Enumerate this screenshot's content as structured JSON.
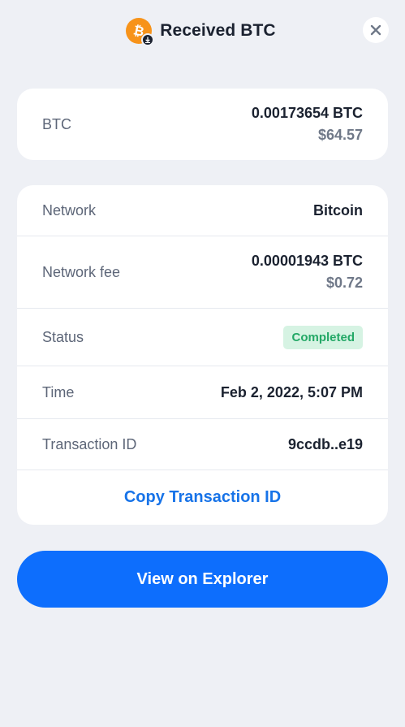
{
  "header": {
    "title": "Received BTC",
    "coin_icon": "bitcoin-icon",
    "badge_icon": "download-arrow-icon",
    "close_icon": "close-icon"
  },
  "amount": {
    "label": "BTC",
    "crypto_value": "0.00173654 BTC",
    "fiat_value": "$64.57"
  },
  "details": {
    "network": {
      "label": "Network",
      "value": "Bitcoin"
    },
    "fee": {
      "label": "Network fee",
      "crypto_value": "0.00001943 BTC",
      "fiat_value": "$0.72"
    },
    "status": {
      "label": "Status",
      "value": "Completed"
    },
    "time": {
      "label": "Time",
      "value": "Feb 2, 2022, 5:07 PM"
    },
    "transaction": {
      "label": "Transaction ID",
      "value": "9ccdb..e19"
    },
    "copy_label": "Copy Transaction ID"
  },
  "explorer_button": {
    "label": "View on Explorer"
  },
  "colors": {
    "background": "#eef0f5",
    "card": "#ffffff",
    "accent": "#0d6efd",
    "link": "#1773e8",
    "bitcoin": "#f7931a",
    "status_bg": "#d6f3e3",
    "status_text": "#23a866"
  }
}
